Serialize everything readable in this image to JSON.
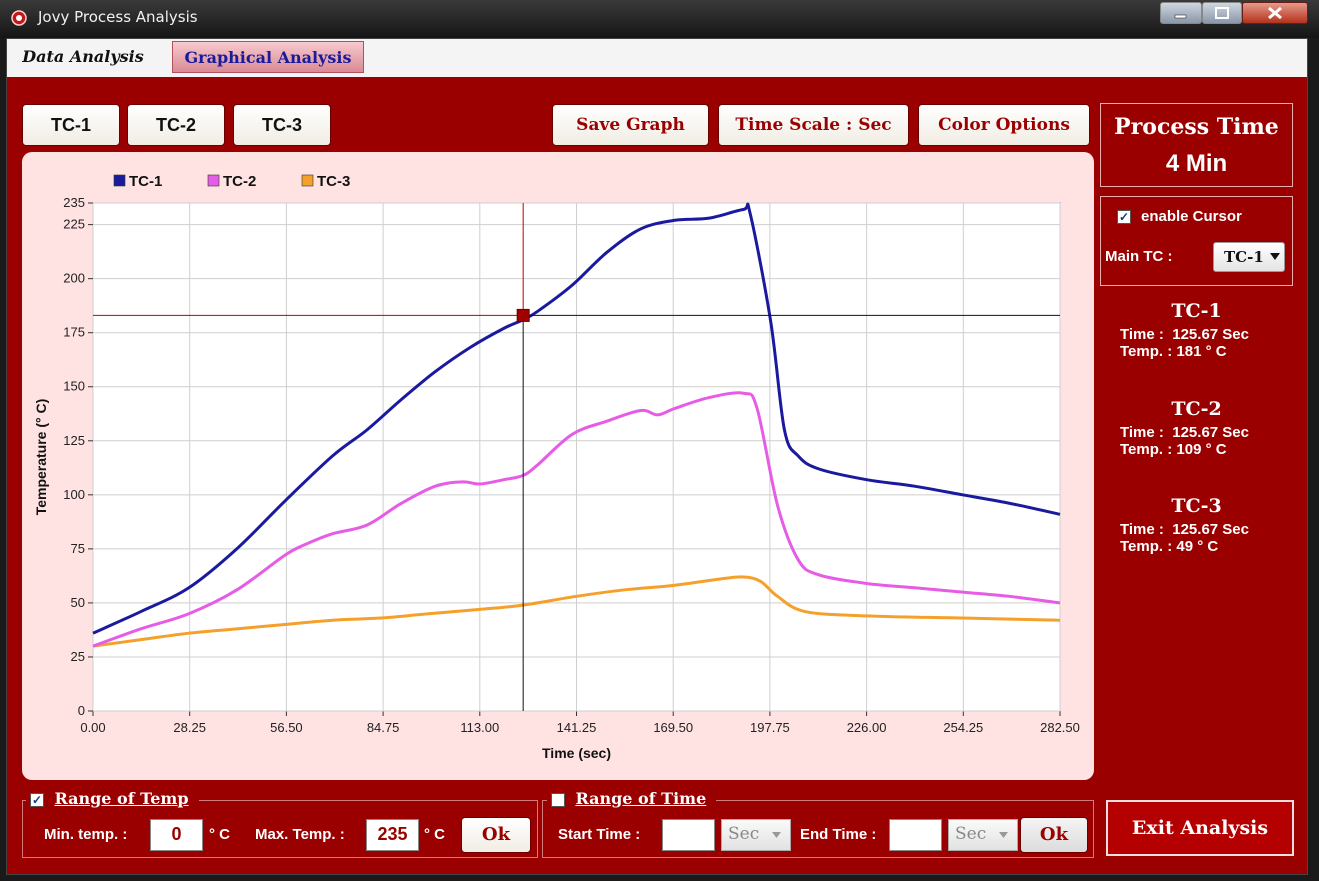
{
  "window": {
    "title": "Jovy Process Analysis"
  },
  "tabs": [
    {
      "label": "Data Analysis",
      "active": false
    },
    {
      "label": "Graphical Analysis",
      "active": true
    }
  ],
  "toolbar": {
    "tc_buttons": [
      "TC-1",
      "TC-2",
      "TC-3"
    ],
    "save_graph": "Save Graph",
    "time_scale": "Time Scale : Sec",
    "color_options": "Color Options"
  },
  "process_time": {
    "title": "Process Time",
    "value": "4 Min"
  },
  "cursor_panel": {
    "enable_label": "enable Cursor",
    "enabled": true,
    "main_tc_label": "Main TC :",
    "main_tc_value": "TC-1"
  },
  "readouts": [
    {
      "name": "TC-1",
      "time_label": "Time :",
      "time_value": "125.67 Sec",
      "temp_label": "Temp. :",
      "temp_value": "181 ° C"
    },
    {
      "name": "TC-2",
      "time_label": "Time :",
      "time_value": "125.67 Sec",
      "temp_label": "Temp. :",
      "temp_value": "109 ° C"
    },
    {
      "name": "TC-3",
      "time_label": "Time :",
      "time_value": "125.67 Sec",
      "temp_label": "Temp. :",
      "temp_value": "49 ° C"
    }
  ],
  "range_temp": {
    "label": "Range of Temp",
    "checked": true,
    "min_label": "Min. temp. :",
    "min_value": "0",
    "unit": "° C",
    "max_label": "Max. Temp. :",
    "max_value": "235",
    "ok": "Ok"
  },
  "range_time": {
    "label": "Range of Time",
    "checked": false,
    "start_label": "Start Time :",
    "start_value": "",
    "start_unit": "Sec",
    "end_label": "End Time :",
    "end_value": "",
    "end_unit": "Sec",
    "ok": "Ok"
  },
  "exit_button": "Exit Analysis",
  "colors": {
    "tc1": "#1a1a9e",
    "tc2": "#e65ce6",
    "tc3": "#f5a02a",
    "frame": "#9b0000",
    "panel": "#ffe3e3"
  },
  "chart_data": {
    "type": "line",
    "xlabel": "Time  (sec)",
    "ylabel": "Temperature (° C)",
    "xlim": [
      0,
      282.5
    ],
    "ylim": [
      0,
      235
    ],
    "x_ticks": [
      "0.00",
      "28.25",
      "56.50",
      "84.75",
      "113.00",
      "141.25",
      "169.50",
      "197.75",
      "226.00",
      "254.25",
      "282.50"
    ],
    "y_ticks": [
      "0",
      "25",
      "50",
      "75",
      "100",
      "125",
      "150",
      "175",
      "200",
      "225",
      "235"
    ],
    "grid": true,
    "legend_position": "top-left",
    "cursor": {
      "x": 125.67,
      "y": 183
    },
    "series": [
      {
        "name": "TC-1",
        "color": "#1a1a9e",
        "x": [
          0,
          14,
          28,
          42,
          56,
          70,
          80,
          90,
          100,
          110,
          120,
          125.67,
          130,
          140,
          150,
          160,
          170,
          180,
          190,
          192,
          198,
          202,
          206,
          212,
          226,
          240,
          254,
          268,
          282.5
        ],
        "y": [
          36,
          46,
          57,
          75,
          97,
          118,
          130,
          144,
          157,
          168,
          177,
          181,
          185,
          197,
          212,
          223,
          227,
          228,
          232,
          230,
          180,
          130,
          118,
          112,
          107,
          104,
          100,
          96,
          91
        ]
      },
      {
        "name": "TC-2",
        "color": "#e65ce6",
        "x": [
          0,
          14,
          28,
          42,
          56,
          62,
          70,
          80,
          90,
          100,
          108,
          113,
          120,
          125.67,
          130,
          140,
          150,
          160,
          165,
          170,
          180,
          190,
          194,
          200,
          206,
          212,
          226,
          240,
          254,
          268,
          282.5
        ],
        "y": [
          30,
          38,
          45,
          56,
          72,
          77,
          82,
          86,
          96,
          104,
          106,
          105,
          107,
          109,
          114,
          128,
          134,
          139,
          137,
          140,
          145,
          147,
          140,
          95,
          70,
          63,
          59,
          57,
          55,
          53,
          50
        ]
      },
      {
        "name": "TC-3",
        "color": "#f5a02a",
        "x": [
          0,
          14,
          28,
          42,
          56,
          70,
          84,
          98,
          113,
          125.67,
          141,
          155,
          169,
          183,
          190,
          195,
          200,
          208,
          226,
          254,
          282.5
        ],
        "y": [
          30,
          33,
          36,
          38,
          40,
          42,
          43,
          45,
          47,
          49,
          53,
          56,
          58,
          61,
          62,
          60,
          53,
          46,
          44,
          43,
          42
        ]
      }
    ]
  }
}
